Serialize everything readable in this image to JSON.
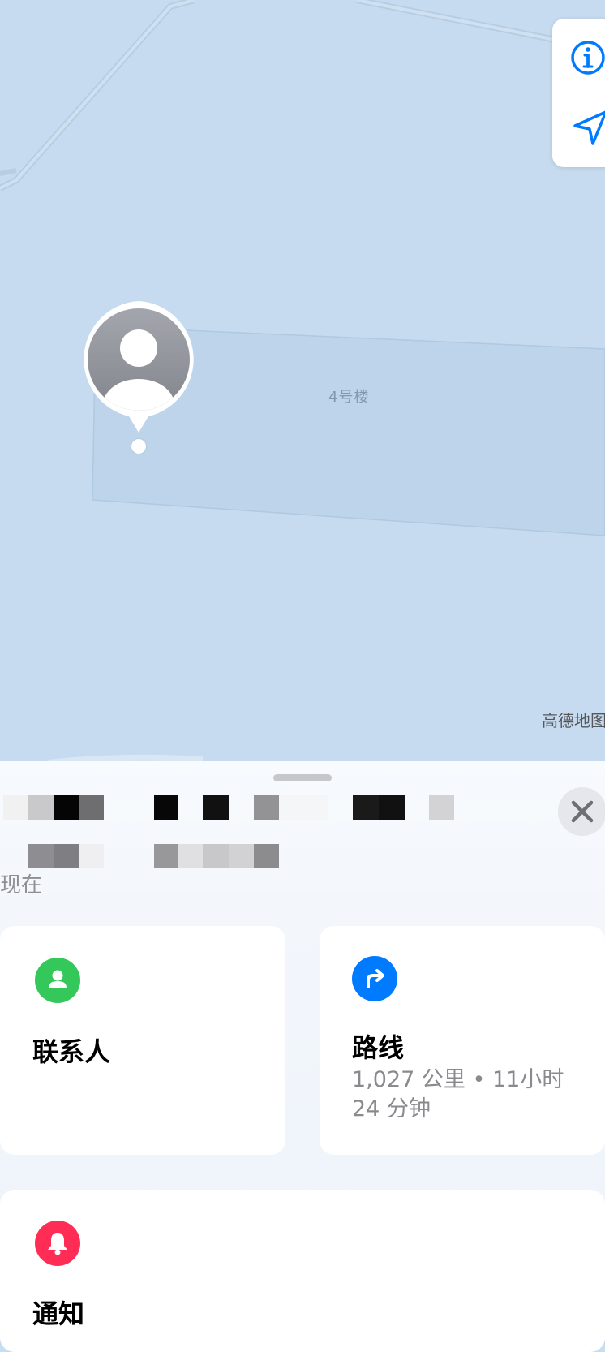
{
  "map": {
    "building_label": "4号楼",
    "attribution": "高德地图",
    "controls": {
      "info_icon": "info-icon",
      "location_icon": "location-arrow-icon"
    },
    "avatar_icon": "person-icon"
  },
  "sheet": {
    "time_text": "现在",
    "close_icon": "close-icon"
  },
  "cards": {
    "contact": {
      "title": "联系人",
      "icon": "person-icon",
      "color": "#34c759"
    },
    "route": {
      "title": "路线",
      "subtitle": "1,027 公里 • 11小时 24 分钟",
      "icon": "turn-right-arrow-icon",
      "color": "#007aff"
    },
    "notify": {
      "title": "通知",
      "icon": "bell-icon",
      "color": "#ff2d55"
    }
  },
  "colors": {
    "map_background": "#c6dbef",
    "accent_blue": "#007aff"
  }
}
